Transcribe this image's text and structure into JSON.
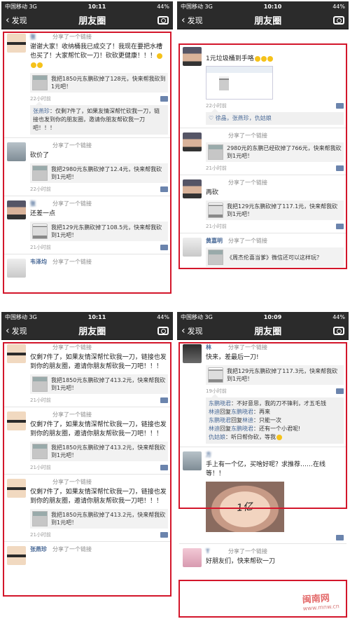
{
  "status": {
    "carrier": "中国移动",
    "network": "3G",
    "battery": "44%",
    "times": [
      "10:11",
      "10:10",
      "10:11",
      "10:09"
    ]
  },
  "nav": {
    "back": "发现",
    "title": "朋友圈"
  },
  "shared_link": "分享了一个链接",
  "panel1": {
    "p1_name": "张",
    "p1_text": "谢谢大家！收纳桶我已成交了！我现在要把水槽也买了！大家帮忙砍一刀！砍砍更健康！！！",
    "p1_link": "我把1850元东鹏砍掉了128元，快来帮我砍到1元吧！",
    "p1_time": "22小时前",
    "p1_c_name": "张燕珍",
    "p1_c_text": "：仅剩7件了，如果友情深帮忙砍我一刀，链接也发到你的朋友圈，邀请你朋友帮砍我一刀吧！！！",
    "p2_text": "砍价了",
    "p2_link": "我把2980元东鹏砍掉了12.4元，快来帮我砍到1元吧！",
    "p2_time": "22小时前",
    "p3_name": "张",
    "p3_text": "还差一点",
    "p3_link": "我把129元东鹏砍掉了108.5元，快来帮我砍到1元吧！",
    "p3_time": "21小时前",
    "p4_name": "韦泽均"
  },
  "panel2": {
    "p1_text": "1元垃圾桶到手咯",
    "p1_time": "22小时前",
    "p1_likes": "徐晶，张燕珍，仇姑娘",
    "p2_link": "2980元的东鹏已经砍掉了766元，快来帮我砍到1元吧！",
    "p2_time": "21小时前",
    "p3_text": "再砍",
    "p3_link": "我把129元东鹏砍掉了117.1元，快来帮我砍到1元吧！",
    "p3_time": "21小时前",
    "p4_name": "黄嘉明",
    "p4_link": "《周杰伦喜当爹》微信还可以这样玩？"
  },
  "panel3": {
    "posts": [
      {
        "text": "仅剩7件了，如果友情深帮忙砍我一刀，链接也发到你的朋友圈，邀请你朋友帮砍我一刀吧！！！",
        "link": "我把1850元东鹏砍掉了413.2元，快来帮我砍到1元吧！",
        "time": "21小时前"
      },
      {
        "text": "仅剩7件了，如果友情深帮忙砍我一刀，链接也发到你的朋友圈，邀请你朋友帮砍我一刀吧！！！",
        "link": "我把1850元东鹏砍掉了413.2元，快来帮我砍到1元吧！",
        "time": "21小时前"
      },
      {
        "text": "仅剩7件了，如果友情深帮忙砍我一刀，链接也发到你的朋友圈，邀请你朋友帮砍我一刀吧！！！",
        "link": "我把1850元东鹏砍掉了413.2元，快来帮我砍到1元吧！",
        "time": "21小时前"
      }
    ],
    "bottom_name": "张燕珍"
  },
  "panel4": {
    "p1_name": "林",
    "p1_text": "快来，差最后一刀!",
    "p1_link": "我把129元东鹏砍掉了117.3元，快来帮我砍到1元吧！",
    "p1_time": "19小时前",
    "c1_name": "东鹏晓君",
    "c1_text": "：不好意思，我的刀不锋利，才五毛钱",
    "c2_name": "林迪",
    "c2_mid": "回复",
    "c2_to": "东鹏晓君",
    "c2_text": "：再来",
    "c3_name": "东鹏晓君",
    "c3_mid": "回复",
    "c3_to": "林迪",
    "c3_text": "：只能一次",
    "c4_name": "林迪",
    "c4_mid": "回复",
    "c4_to": "东鹏晓君",
    "c4_text": "：还有一个小君呢!",
    "c5_name": "仇姑娘",
    "c5_text": "：听日帮你砍，等我",
    "p2_name": "方",
    "p2_text": "手上有一个亿，买啥好呢？求推荐……在线等！！",
    "p2_hand": "1亿",
    "p3_name": "T",
    "p3_text": "好朋友们，快来帮砍一刀"
  },
  "watermark": {
    "main": "闽南网",
    "sub": "www.mnw.cn"
  }
}
